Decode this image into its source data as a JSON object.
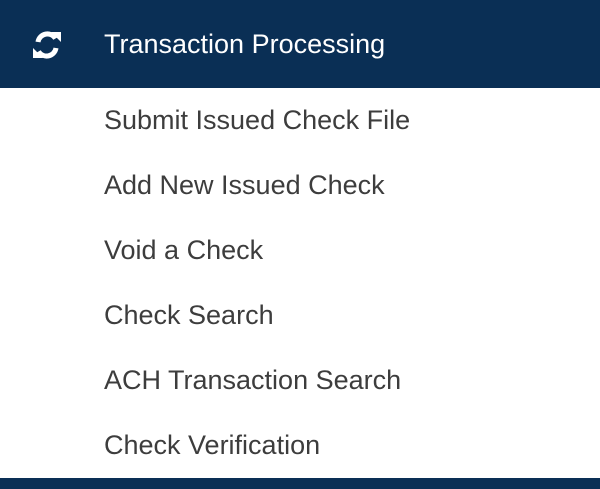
{
  "header": {
    "icon": "refresh-icon",
    "label": "Transaction Processing"
  },
  "items": [
    {
      "label": "Submit Issued Check File"
    },
    {
      "label": "Add New Issued Check"
    },
    {
      "label": "Void a Check"
    },
    {
      "label": "Check Search"
    },
    {
      "label": "ACH Transaction Search"
    },
    {
      "label": "Check Verification"
    }
  ],
  "colors": {
    "header_background": "#0a2f55",
    "header_text": "#ffffff",
    "item_text": "#3d3d3d"
  }
}
